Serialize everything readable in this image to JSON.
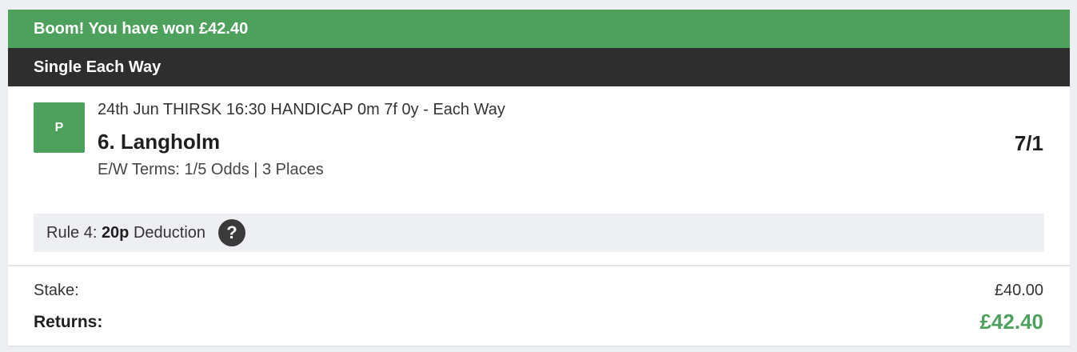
{
  "banner": {
    "message": "Boom! You have won £42.40",
    "color": "#4ea15d"
  },
  "bet": {
    "type": "Single Each Way"
  },
  "selection": {
    "result_badge": "P",
    "event": "24th Jun THIRSK 16:30 HANDICAP 0m 7f 0y - Each Way",
    "runner": "6. Langholm",
    "odds": "7/1",
    "ew_terms": "E/W Terms: 1/5 Odds | 3 Places"
  },
  "rule4": {
    "prefix": "Rule 4:",
    "amount": "20p",
    "suffix": "Deduction",
    "help_icon": "question-circle-icon"
  },
  "totals": {
    "stake_label": "Stake:",
    "stake_value": "£40.00",
    "returns_label": "Returns:",
    "returns_value": "£42.40",
    "returns_color": "#4ea15d"
  }
}
